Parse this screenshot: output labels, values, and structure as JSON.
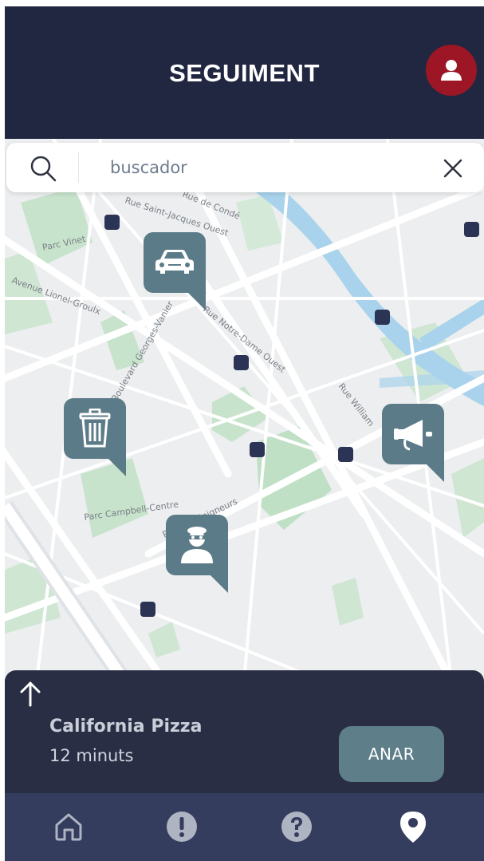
{
  "header": {
    "title": "SEGUIMENT"
  },
  "search": {
    "placeholder": "buscador"
  },
  "map": {
    "labels": {
      "parc_vinet": "Parc Vinet",
      "lionel_groulx": "Avenue Lionel-Groulx",
      "georges_vanier": "Boulevard Georges-Vanier",
      "notre_dame": "Rue Notre-Dame Ouest",
      "william": "Rue William",
      "seigneurs": "Rue des Seigneurs",
      "parc_campbell": "Parc Campbell-Centre",
      "saint_jacques": "Rue Saint-Jacques Ouest",
      "top_edge": "Rue de Condé"
    },
    "markers": [
      "car-icon",
      "trash-icon",
      "megaphone-icon",
      "thief-icon"
    ]
  },
  "sheet": {
    "place_name": "California Pizza",
    "duration": "12 minuts",
    "go_label": "ANAR"
  },
  "tabbar": [
    "home-icon",
    "alert-icon",
    "help-icon",
    "location-icon"
  ],
  "colors": {
    "header": "#212740",
    "avatar": "#9c1626",
    "marker": "#5c7b88",
    "sheet": "#292e44",
    "tabbar": "#353d5e",
    "button": "#5e7e89"
  }
}
